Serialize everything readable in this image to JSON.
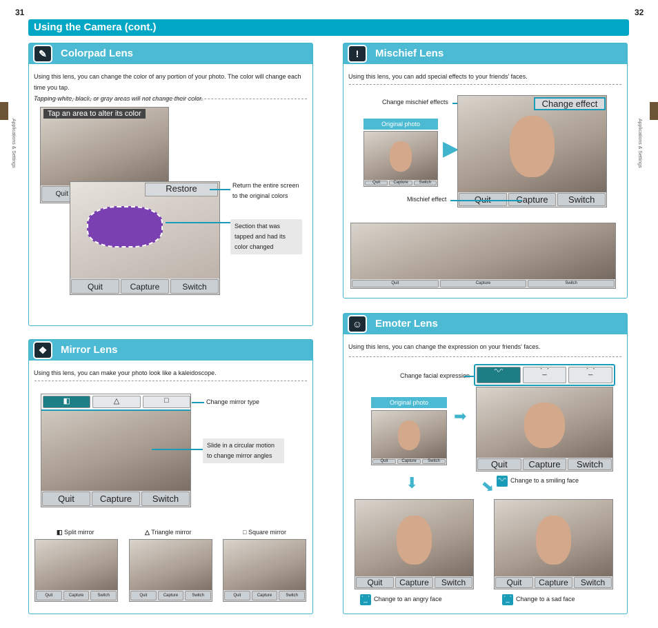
{
  "page_left": "31",
  "page_right": "32",
  "header": "Using the Camera (cont.)",
  "side_label": "Applications & Settings",
  "screen_buttons": {
    "quit": "Quit",
    "capture": "Capture",
    "switch": "Switch"
  },
  "colorpad": {
    "title": "Colorpad Lens",
    "desc": "Using this lens, you can change the color of any portion of your photo. The color will change each time you tap.",
    "note": "Tapping white, black, or gray areas will not change their color.",
    "screen_prompt": "Tap an area to alter its color",
    "restore": "Restore",
    "callout_restore": "Return the entire screen to the original colors",
    "callout_section": "Section that was tapped and had its color changed"
  },
  "mirror": {
    "title": "Mirror Lens",
    "desc": "Using this lens, you can make your photo look like a kaleidoscope.",
    "callout_type": "Change mirror type",
    "callout_slide": "Slide in a circular motion to change mirror angles",
    "modes": [
      {
        "icon": "◧",
        "label": "Split mirror"
      },
      {
        "icon": "△",
        "label": "Triangle mirror"
      },
      {
        "icon": "□",
        "label": "Square mirror"
      }
    ]
  },
  "mischief": {
    "title": "Mischief Lens",
    "desc": "Using this lens, you can add special effects to your friends' faces.",
    "callout_change": "Change mischief effects",
    "callout_effect": "Mischief effect",
    "original": "Original photo",
    "change_effect": "Change effect"
  },
  "emoter": {
    "title": "Emoter Lens",
    "desc": "Using this lens, you can change the expression on your friends' faces.",
    "callout_change": "Change facial expression",
    "original": "Original photo",
    "smile": "Change to a smiling face",
    "angry": "Change to an angry face",
    "sad": "Change to a sad face",
    "expr_icons": [
      "ᵔᵕᵔ",
      "ˋ_ˊ",
      "ˊ_ˋ"
    ]
  },
  "colors": {
    "accent": "#00a7c4",
    "title_bar": "#4cbad2",
    "tab": "#6b5536"
  }
}
